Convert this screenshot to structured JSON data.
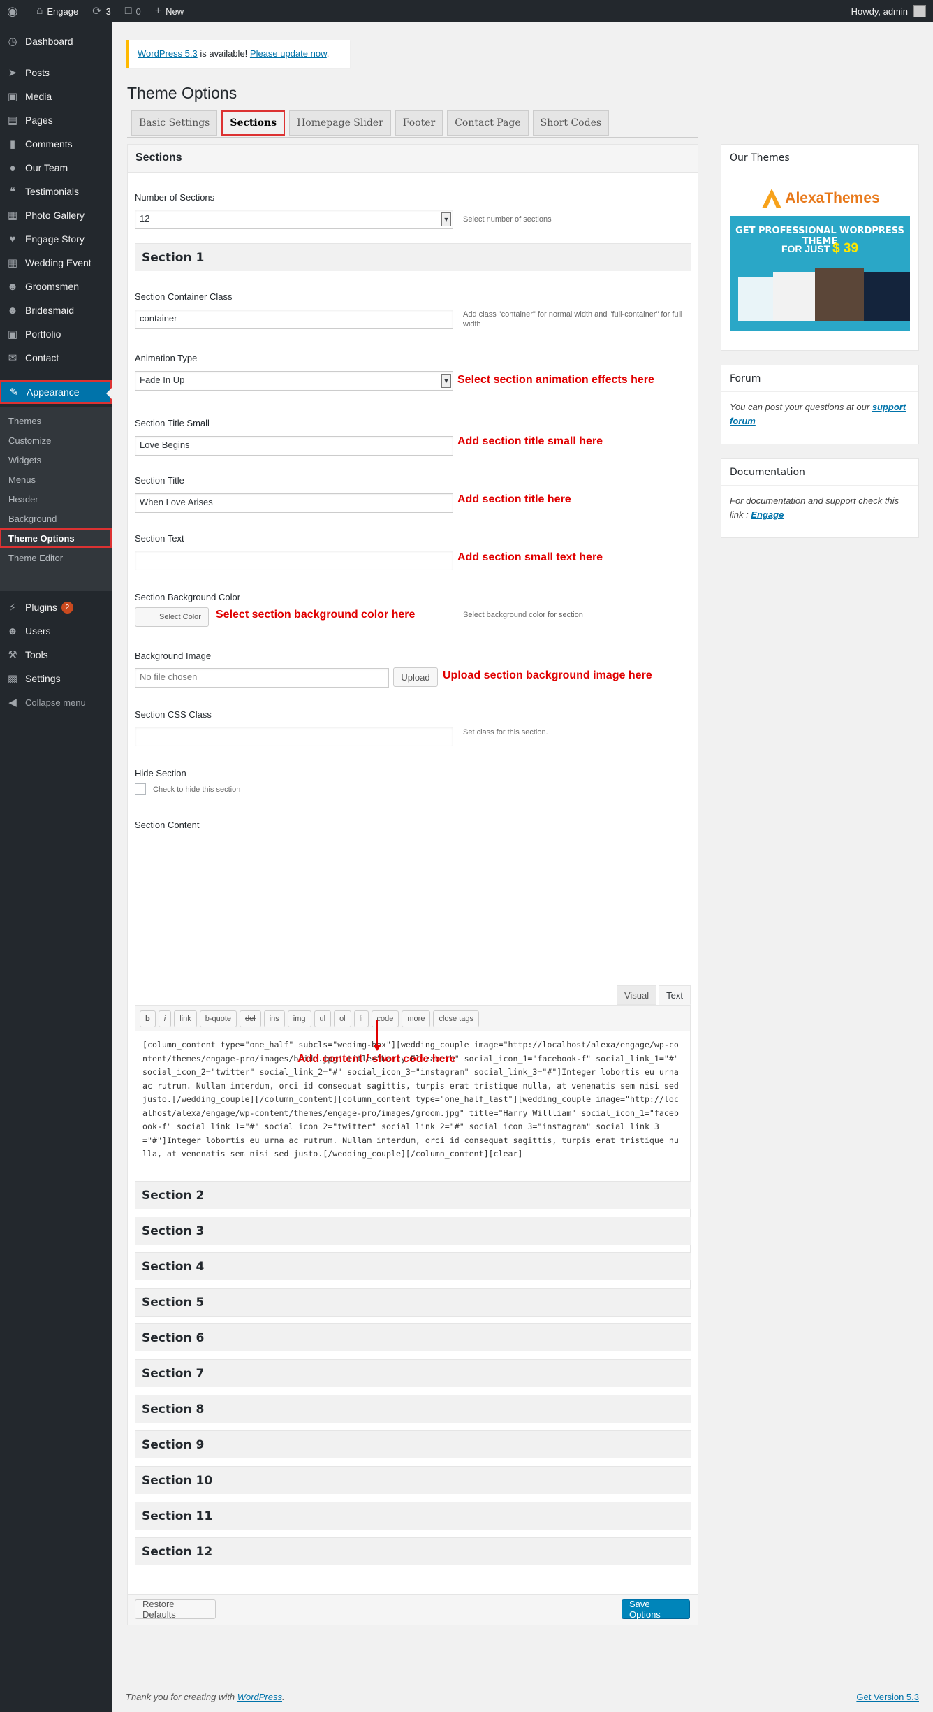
{
  "adminbar": {
    "site_name": "Engage",
    "updates_count": "3",
    "comments_count": "0",
    "new_label": "New",
    "greeting": "Howdy, admin"
  },
  "sidebar": {
    "items": [
      {
        "label": "Dashboard",
        "icon": "gauge-icon"
      },
      {
        "label": "Posts",
        "icon": "pin-icon"
      },
      {
        "label": "Media",
        "icon": "media-icon"
      },
      {
        "label": "Pages",
        "icon": "page-icon"
      },
      {
        "label": "Comments",
        "icon": "comment-icon"
      },
      {
        "label": "Our Team",
        "icon": "team-icon"
      },
      {
        "label": "Testimonials",
        "icon": "quote-icon"
      },
      {
        "label": "Photo Gallery",
        "icon": "gallery-icon"
      },
      {
        "label": "Engage Story",
        "icon": "heart-icon"
      },
      {
        "label": "Wedding Event",
        "icon": "calendar-icon"
      },
      {
        "label": "Groomsmen",
        "icon": "person-icon"
      },
      {
        "label": "Bridesmaid",
        "icon": "person-icon"
      },
      {
        "label": "Portfolio",
        "icon": "portfolio-icon"
      },
      {
        "label": "Contact",
        "icon": "mail-icon"
      },
      {
        "label": "Appearance",
        "icon": "brush-icon"
      }
    ],
    "submenu": [
      "Themes",
      "Customize",
      "Widgets",
      "Menus",
      "Header",
      "Background",
      "Theme Options",
      "Theme Editor"
    ],
    "bottom_items": [
      {
        "label": "Plugins",
        "icon": "plugin-icon",
        "badge": "2"
      },
      {
        "label": "Users",
        "icon": "users-icon"
      },
      {
        "label": "Tools",
        "icon": "wrench-icon"
      },
      {
        "label": "Settings",
        "icon": "settings-icon"
      },
      {
        "label": "Collapse menu",
        "icon": "collapse-icon"
      }
    ]
  },
  "notice": {
    "version_link": "WordPress 5.3",
    "text": " is available! ",
    "update_link": "Please update now",
    "end": "."
  },
  "page": {
    "title": "Theme Options",
    "tabs": [
      "Basic Settings",
      "Sections",
      "Homepage Slider",
      "Footer",
      "Contact Page",
      "Short Codes"
    ]
  },
  "panel": {
    "heading": "Sections",
    "number_label": "Number of Sections",
    "number_value": "12",
    "number_desc": "Select number of sections",
    "section1_title": "Section 1",
    "container_label": "Section Container Class",
    "container_value": "container",
    "container_desc": "Add class \"container\" for normal width and \"full-container\" for full width",
    "animation_label": "Animation Type",
    "animation_value": "Fade In Up",
    "animation_note": "Select section animation effects here",
    "title_small_label": "Section Title Small",
    "title_small_value": "Love Begins",
    "title_small_note": "Add section title small here",
    "title_label": "Section Title",
    "title_value": "When Love Arises",
    "title_note": "Add section title here",
    "text_label": "Section Text",
    "text_value": "",
    "text_note": "Add section small text here",
    "bg_color_label": "Section Background Color",
    "bg_color_button": "Select Color",
    "bg_color_note": "Select section background color here",
    "bg_color_desc": "Select background color for section",
    "bg_image_label": "Background Image",
    "bg_image_value": "No file chosen",
    "upload_button": "Upload",
    "bg_image_note": "Upload section background image here",
    "css_label": "Section CSS Class",
    "css_value": "",
    "css_desc": "Set class for this section.",
    "hide_label": "Hide Section",
    "hide_checkbox_label": "Check to hide this section",
    "content_label": "Section Content",
    "editor_tabs": [
      "Visual",
      "Text"
    ],
    "quicktags": [
      "b",
      "i",
      "link",
      "b-quote",
      "del",
      "ins",
      "img",
      "ul",
      "ol",
      "li",
      "code",
      "more",
      "close tags"
    ],
    "editor_content": "[column_content type=\"one_half\" subcls=\"wedimg-box\"][wedding_couple image=\"http://localhost/alexa/engage/wp-content/themes/engage-pro/images/bride.jpg\" title=\"Nancy Elizabeth\" social_icon_1=\"facebook-f\" social_link_1=\"#\" social_icon_2=\"twitter\" social_link_2=\"#\" social_icon_3=\"instagram\" social_link_3=\"#\"]Integer lobortis eu urna ac rutrum. Nullam interdum, orci id consequat sagittis, turpis erat tristique nulla, at venenatis sem nisi sed justo.[/wedding_couple][/column_content][column_content type=\"one_half_last\"][wedding_couple image=\"http://localhost/alexa/engage/wp-content/themes/engage-pro/images/groom.jpg\" title=\"Harry Willliam\" social_icon_1=\"facebook-f\" social_link_1=\"#\" social_icon_2=\"twitter\" social_link_2=\"#\" social_icon_3=\"instagram\" social_link_3=\"#\"]Integer lobortis eu urna ac rutrum. Nullam interdum, orci id consequat sagittis, turpis erat tristique nulla, at venenatis sem nisi sed justo.[/wedding_couple][/column_content][clear]",
    "content_note": "Add content / short code here",
    "other_sections": [
      "Section 2",
      "Section 3",
      "Section 4",
      "Section 5",
      "Section 6",
      "Section 7",
      "Section 8",
      "Section 9",
      "Section 10",
      "Section 11",
      "Section 12"
    ],
    "restore_button": "Restore Defaults",
    "save_button": "Save Options"
  },
  "widgets": {
    "themes_title": "Our Themes",
    "banner_brand": "AlexaThemes",
    "banner_line1": "GET PROFESSIONAL WORDPRESS THEME",
    "banner_line2": "FOR JUST",
    "banner_price": "$ 39",
    "forum_title": "Forum",
    "forum_text": "You can post your questions at our ",
    "forum_link": "support forum",
    "doc_title": "Documentation",
    "doc_text": "For documentation and support check this link : ",
    "doc_link": "Engage"
  },
  "footer": {
    "thanks_text": "Thank you for creating with ",
    "thanks_link": "WordPress",
    "thanks_end": ".",
    "version_link": "Get Version 5.3"
  },
  "colors": {
    "admin_dark": "#23282d",
    "accent_blue": "#0073aa",
    "highlight_red": "#dc3232",
    "note_red": "#e00000",
    "notice_yellow": "#ffb900"
  }
}
